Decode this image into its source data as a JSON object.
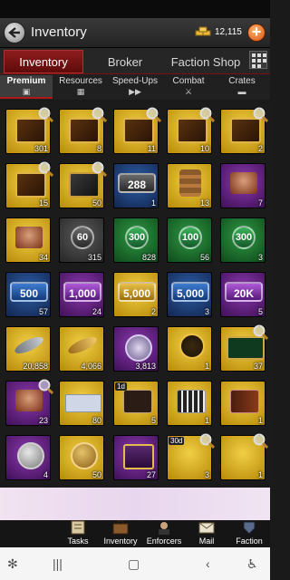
{
  "header": {
    "title": "Inventory",
    "gold_amount": "12,115",
    "add_label": "+"
  },
  "main_tabs": [
    {
      "label": "Inventory",
      "active": true
    },
    {
      "label": "Broker",
      "active": false
    },
    {
      "label": "Faction Shop",
      "active": false
    }
  ],
  "sub_tabs": [
    {
      "label": "Premium",
      "icon": "cube-icon",
      "active": true
    },
    {
      "label": "Resources",
      "icon": "resources-icon",
      "active": false
    },
    {
      "label": "Speed-Ups",
      "icon": "fast-forward-icon",
      "active": false
    },
    {
      "label": "Combat",
      "icon": "combat-icon",
      "active": false
    },
    {
      "label": "Crates",
      "icon": "crate-icon",
      "active": false
    }
  ],
  "items": [
    {
      "count": "301",
      "bg": "gold",
      "pic": "card",
      "mag": true
    },
    {
      "count": "8",
      "bg": "gold",
      "pic": "card",
      "mag": true
    },
    {
      "count": "11",
      "bg": "gold",
      "pic": "card",
      "mag": true
    },
    {
      "count": "10",
      "bg": "gold",
      "pic": "card",
      "mag": true
    },
    {
      "count": "2",
      "bg": "gold",
      "pic": "card",
      "mag": true
    },
    {
      "count": "15",
      "bg": "gold",
      "pic": "card",
      "mag": true
    },
    {
      "count": "50",
      "bg": "gold",
      "pic": "dark",
      "mag": true
    },
    {
      "count": "1",
      "bg": "blue",
      "pic": "plaque",
      "plaque": "288",
      "pcolor": "gray"
    },
    {
      "count": "13",
      "bg": "gold",
      "pic": "box"
    },
    {
      "count": "7",
      "bg": "purple",
      "pic": "portrait"
    },
    {
      "count": "34",
      "bg": "gold",
      "pic": "portrait"
    },
    {
      "count": "315",
      "bg": "gray",
      "pic": "plaque",
      "plaque": "60",
      "pcolor": "gray",
      "disc": true
    },
    {
      "count": "828",
      "bg": "green",
      "pic": "plaque",
      "plaque": "300",
      "pcolor": "green",
      "disc": true
    },
    {
      "count": "56",
      "bg": "green",
      "pic": "plaque",
      "plaque": "100",
      "pcolor": "green",
      "disc": true
    },
    {
      "count": "3",
      "bg": "green",
      "pic": "plaque",
      "plaque": "300",
      "pcolor": "green",
      "disc": true
    },
    {
      "count": "57",
      "bg": "blue",
      "pic": "plaque",
      "plaque": "500",
      "pcolor": "blue"
    },
    {
      "count": "24",
      "bg": "purple",
      "pic": "plaque",
      "plaque": "1,000",
      "pcolor": "purple"
    },
    {
      "count": "2",
      "bg": "gold",
      "pic": "plaque",
      "plaque": "5,000",
      "pcolor": "gold"
    },
    {
      "count": "3",
      "bg": "blue",
      "pic": "plaque",
      "plaque": "5,000",
      "pcolor": "blue"
    },
    {
      "count": "5",
      "bg": "purple",
      "pic": "plaque",
      "plaque": "20K",
      "pcolor": "purple"
    },
    {
      "count": "20,858",
      "bg": "gold",
      "pic": "feather-grey"
    },
    {
      "count": "4,066",
      "bg": "gold",
      "pic": "feather-gold"
    },
    {
      "count": "3,813",
      "bg": "purple",
      "pic": "rosette"
    },
    {
      "count": "1",
      "bg": "gold",
      "pic": "star"
    },
    {
      "count": "37",
      "bg": "gold",
      "pic": "badge",
      "mag": true
    },
    {
      "count": "23",
      "bg": "purple",
      "pic": "portrait",
      "mag": true
    },
    {
      "count": "80",
      "bg": "gold",
      "pic": "note"
    },
    {
      "count": "5",
      "bg": "gold",
      "pic": "crate",
      "tag": "1d"
    },
    {
      "count": "1",
      "bg": "gold",
      "pic": "film"
    },
    {
      "count": "1",
      "bg": "gold",
      "pic": "book"
    },
    {
      "count": "4",
      "bg": "purple",
      "pic": "silvercoin"
    },
    {
      "count": "50",
      "bg": "gold",
      "pic": "coin"
    },
    {
      "count": "27",
      "bg": "purple",
      "pic": "chest"
    },
    {
      "count": "3",
      "bg": "gold",
      "pic": "blank",
      "tag": "30d",
      "mag": true
    },
    {
      "count": "1",
      "bg": "gold",
      "pic": "blank",
      "mag": true
    }
  ],
  "bottom_nav": [
    {
      "label": "Tasks"
    },
    {
      "label": "Inventory"
    },
    {
      "label": "Enforcers"
    },
    {
      "label": "Mail"
    },
    {
      "label": "Faction"
    }
  ],
  "colors": {
    "accent": "#8e1c1c",
    "gold_bg": "#d9ad22"
  }
}
